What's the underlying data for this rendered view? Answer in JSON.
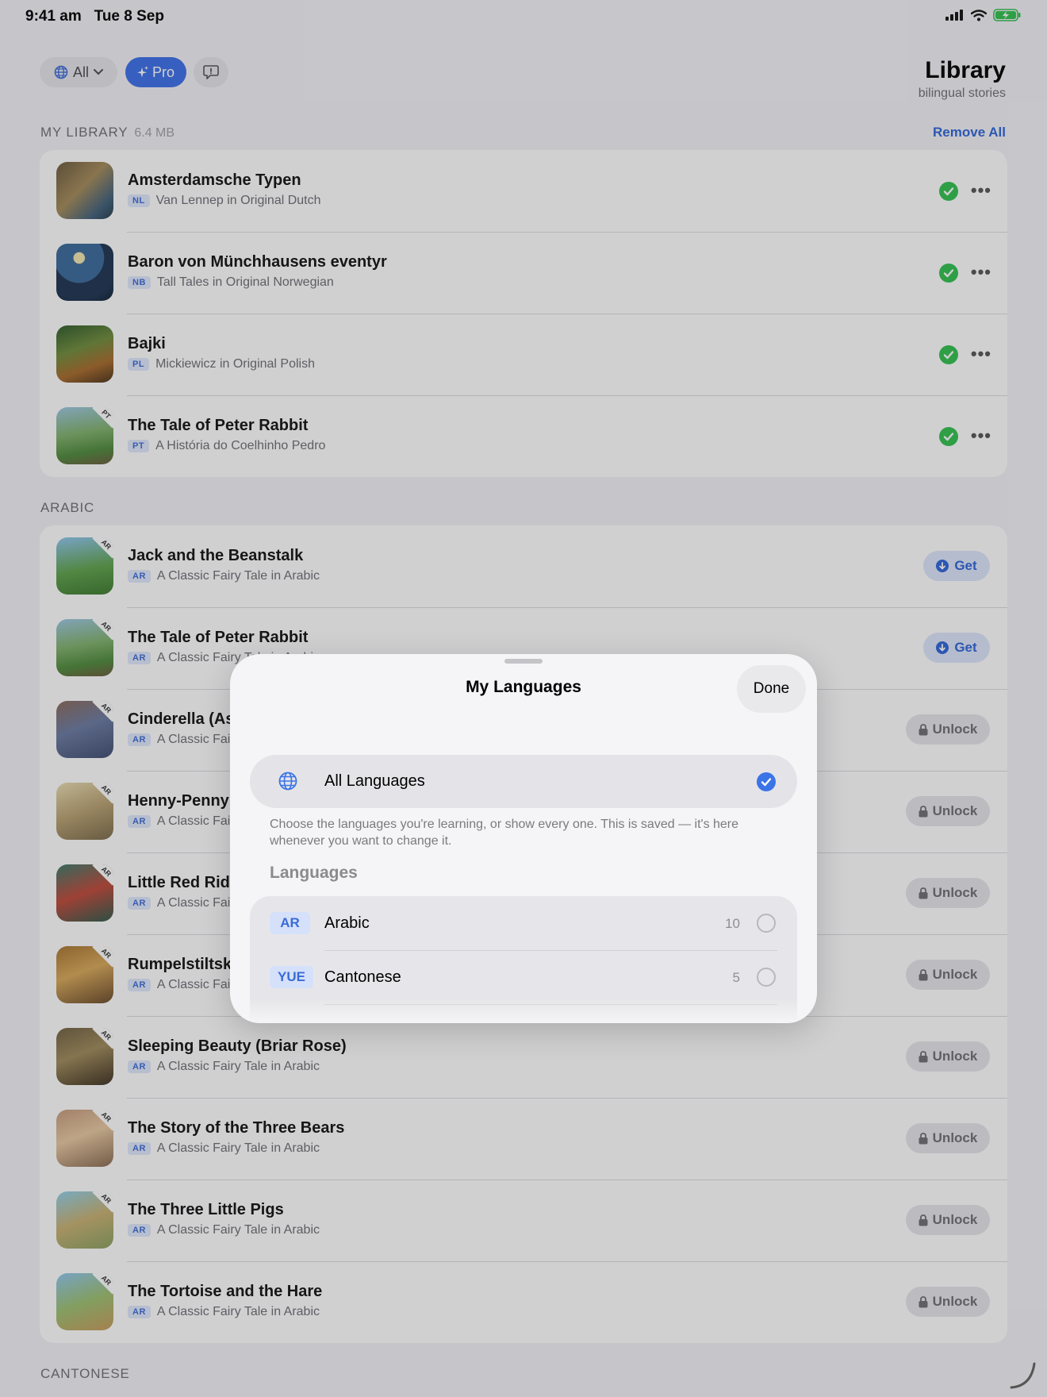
{
  "status_bar": {
    "time": "9:41 am",
    "date": "Tue 8 Sep",
    "icons": [
      "signal-icon",
      "wifi-icon",
      "battery-charging-icon"
    ]
  },
  "toolbar": {
    "filter_label": "All",
    "filter_icon": "globe-icon",
    "pro_label": "Pro",
    "pro_icon": "sparkles-icon",
    "feedback_icon": "speech-bubble-icon"
  },
  "header": {
    "title": "Library",
    "subtitle": "bilingual stories"
  },
  "my_library": {
    "heading": "MY LIBRARY",
    "size": "6.4 MB",
    "remove_all": "Remove All",
    "items": [
      {
        "title": "Amsterdamsche Typen",
        "tag": "NL",
        "subtitle": "Van Lennep in Original Dutch"
      },
      {
        "title": "Baron von Münchhausens eventyr",
        "tag": "NB",
        "subtitle": "Tall Tales in Original Norwegian"
      },
      {
        "title": "Bajki",
        "tag": "PL",
        "subtitle": "Mickiewicz in Original Polish"
      },
      {
        "title": "The Tale of Peter Rabbit",
        "tag": "PT",
        "subtitle": "A História do Coelhinho Pedro",
        "badge": "PT"
      }
    ]
  },
  "arabic": {
    "heading": "ARABIC",
    "get_label": "Get",
    "unlock_label": "Unlock",
    "items": [
      {
        "title": "Jack and the Beanstalk",
        "tag": "AR",
        "subtitle": "A Classic Fairy Tale in Arabic",
        "badge": "AR",
        "action": "get"
      },
      {
        "title": "The Tale of Peter Rabbit",
        "tag": "AR",
        "subtitle": "A Classic Fairy Tale in Arabic",
        "badge": "AR",
        "action": "get"
      },
      {
        "title": "Cinderella (Ash Pussie)",
        "tag": "AR",
        "subtitle": "A Classic Fairy Tale in Arabic",
        "badge": "AR",
        "action": "unlock"
      },
      {
        "title": "Henny-Penny",
        "tag": "AR",
        "subtitle": "A Classic Fairy Tale in Arabic",
        "badge": "AR",
        "action": "unlock"
      },
      {
        "title": "Little Red Riding-Hood",
        "tag": "AR",
        "subtitle": "A Classic Fairy Tale in Arabic",
        "badge": "AR",
        "action": "unlock"
      },
      {
        "title": "Rumpelstiltskin",
        "tag": "AR",
        "subtitle": "A Classic Fairy Tale in Arabic",
        "badge": "AR",
        "action": "unlock"
      },
      {
        "title": "Sleeping Beauty (Briar Rose)",
        "tag": "AR",
        "subtitle": "A Classic Fairy Tale in Arabic",
        "badge": "AR",
        "action": "unlock"
      },
      {
        "title": "The Story of the Three Bears",
        "tag": "AR",
        "subtitle": "A Classic Fairy Tale in Arabic",
        "badge": "AR",
        "action": "unlock"
      },
      {
        "title": "The Three Little Pigs",
        "tag": "AR",
        "subtitle": "A Classic Fairy Tale in Arabic",
        "badge": "AR",
        "action": "unlock"
      },
      {
        "title": "The Tortoise and the Hare",
        "tag": "AR",
        "subtitle": "A Classic Fairy Tale in Arabic",
        "badge": "AR",
        "action": "unlock"
      }
    ]
  },
  "cantonese": {
    "heading": "CANTONESE"
  },
  "sheet": {
    "title": "My Languages",
    "done": "Done",
    "all_languages": "All Languages",
    "help": "Choose the languages you're learning, or show every one. This is saved — it's here whenever you want to change it.",
    "languages_heading": "Languages",
    "languages": [
      {
        "code": "AR",
        "name": "Arabic",
        "count": "10"
      },
      {
        "code": "YUE",
        "name": "Cantonese",
        "count": "5"
      },
      {
        "code": "",
        "name": "",
        "count": ""
      }
    ]
  },
  "colors": {
    "accent": "#3c6fe8",
    "success": "#31c04e",
    "link": "#2e64d8"
  }
}
